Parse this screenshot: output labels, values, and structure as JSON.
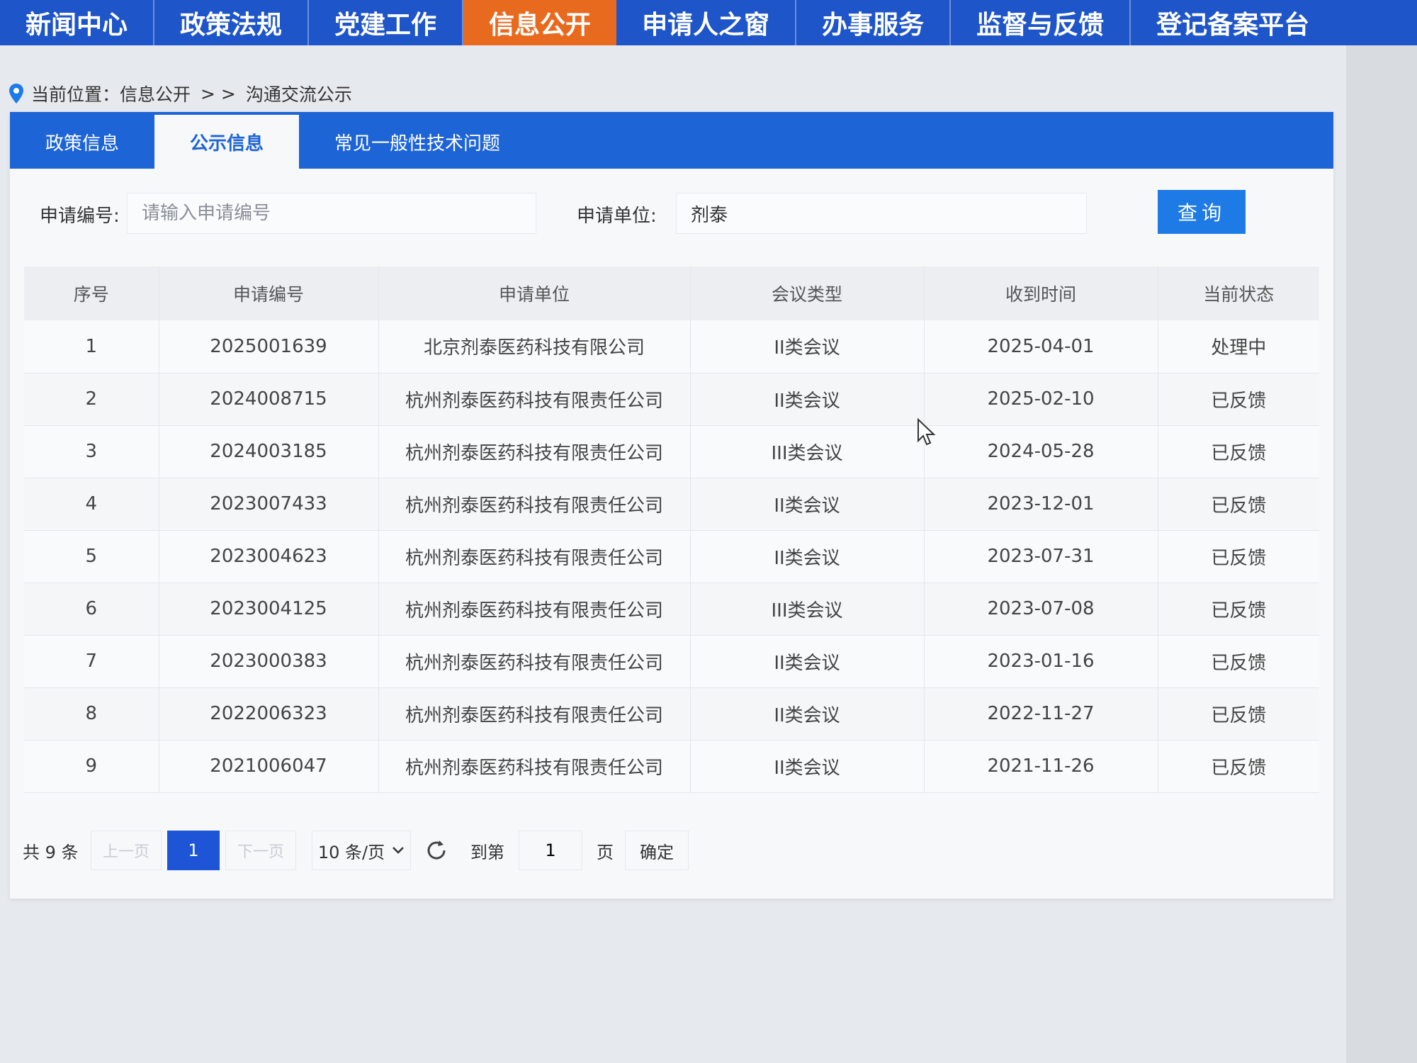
{
  "topnav": {
    "items": [
      {
        "label": "新闻中心",
        "active": false
      },
      {
        "label": "政策法规",
        "active": false
      },
      {
        "label": "党建工作",
        "active": false
      },
      {
        "label": "信息公开",
        "active": true
      },
      {
        "label": "申请人之窗",
        "active": false
      },
      {
        "label": "办事服务",
        "active": false
      },
      {
        "label": "监督与反馈",
        "active": false
      },
      {
        "label": "登记备案平台",
        "active": false
      }
    ]
  },
  "breadcrumb": {
    "prefix": "当前位置：",
    "section": "信息公开",
    "separator": "> >",
    "current": "沟通交流公示"
  },
  "tabs": [
    {
      "label": "政策信息",
      "active": false
    },
    {
      "label": "公示信息",
      "active": true
    },
    {
      "label": "常见一般性技术问题",
      "active": false
    }
  ],
  "search": {
    "app_no_label": "申请编号:",
    "app_no_value": "",
    "app_no_placeholder": "请输入申请编号",
    "unit_label": "申请单位:",
    "unit_value": "剂泰",
    "query_button": "查询"
  },
  "table": {
    "columns": [
      "序号",
      "申请编号",
      "申请单位",
      "会议类型",
      "收到时间",
      "当前状态"
    ],
    "rows": [
      [
        "1",
        "2025001639",
        "北京剂泰医药科技有限公司",
        "II类会议",
        "2025-04-01",
        "处理中"
      ],
      [
        "2",
        "2024008715",
        "杭州剂泰医药科技有限责任公司",
        "II类会议",
        "2025-02-10",
        "已反馈"
      ],
      [
        "3",
        "2024003185",
        "杭州剂泰医药科技有限责任公司",
        "III类会议",
        "2024-05-28",
        "已反馈"
      ],
      [
        "4",
        "2023007433",
        "杭州剂泰医药科技有限责任公司",
        "II类会议",
        "2023-12-01",
        "已反馈"
      ],
      [
        "5",
        "2023004623",
        "杭州剂泰医药科技有限责任公司",
        "II类会议",
        "2023-07-31",
        "已反馈"
      ],
      [
        "6",
        "2023004125",
        "杭州剂泰医药科技有限责任公司",
        "III类会议",
        "2023-07-08",
        "已反馈"
      ],
      [
        "7",
        "2023000383",
        "杭州剂泰医药科技有限责任公司",
        "II类会议",
        "2023-01-16",
        "已反馈"
      ],
      [
        "8",
        "2022006323",
        "杭州剂泰医药科技有限责任公司",
        "II类会议",
        "2022-11-27",
        "已反馈"
      ],
      [
        "9",
        "2021006047",
        "杭州剂泰医药科技有限责任公司",
        "II类会议",
        "2021-11-26",
        "已反馈"
      ]
    ]
  },
  "pagination": {
    "total": "共 9 条",
    "prev": "上一页",
    "current_page": "1",
    "next": "下一页",
    "page_size": "10 条/页",
    "goto_label": "到第",
    "goto_value": "1",
    "page_suffix": "页",
    "confirm": "确定"
  },
  "icons": {
    "pin": "location-pin-icon",
    "refresh": "refresh-icon",
    "chevron": "chevron-down-icon",
    "cursor": "mouse-cursor-icon"
  },
  "colors": {
    "nav_bg": "#1e55c8",
    "nav_active": "#e86a1f",
    "tabbar_bg": "#1d64d6",
    "query_button": "#1e7be6",
    "page_active": "#1d55d6"
  }
}
